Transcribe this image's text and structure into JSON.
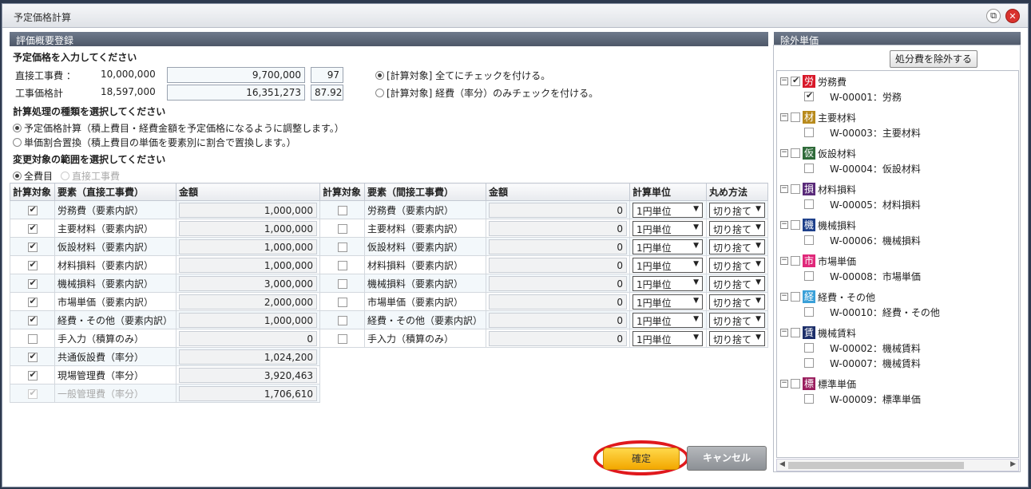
{
  "window": {
    "title": "予定価格計算"
  },
  "left": {
    "header": "評価概要登録",
    "price_section": {
      "label": "予定価格を入力してください",
      "direct": {
        "label": "直接工事費 ：",
        "base": "10,000,000",
        "value": "9,700,000",
        "ratio": "97"
      },
      "total": {
        "label": "工事価格計",
        "base": "18,597,000",
        "value": "16,351,273",
        "ratio": "87.92"
      },
      "check_opts": [
        "[計算対象] 全てにチェックを付ける。",
        "[計算対象] 経費（率分）のみチェックを付ける。"
      ]
    },
    "process_section": {
      "label": "計算処理の種類を選択してください",
      "options": [
        "予定価格計算（積上費目・経費金額を予定価格になるように調整します。）",
        "単価割合置換（積上費目の単価を要素別に割合で置換します。）"
      ]
    },
    "range_section": {
      "label": "変更対象の範囲を選択してください",
      "options": [
        "全費目",
        "直接工事費"
      ]
    },
    "table": {
      "headers": [
        "計算対象",
        "要素（直接工事費）",
        "金額",
        "計算対象",
        "要素（間接工事費）",
        "金額",
        "計算単位",
        "丸め方法"
      ],
      "rows": [
        {
          "name": "労務費（要素内訳）",
          "amount": "1,000,000",
          "name2": "労務費（要素内訳）",
          "amount2": "0",
          "unit": "1円単位",
          "round": "切り捨て"
        },
        {
          "name": "主要材料（要素内訳）",
          "amount": "1,000,000",
          "name2": "主要材料（要素内訳）",
          "amount2": "0",
          "unit": "1円単位",
          "round": "切り捨て"
        },
        {
          "name": "仮設材料（要素内訳）",
          "amount": "1,000,000",
          "name2": "仮設材料（要素内訳）",
          "amount2": "0",
          "unit": "1円単位",
          "round": "切り捨て"
        },
        {
          "name": "材料損料（要素内訳）",
          "amount": "1,000,000",
          "name2": "材料損料（要素内訳）",
          "amount2": "0",
          "unit": "1円単位",
          "round": "切り捨て"
        },
        {
          "name": "機械損料（要素内訳）",
          "amount": "3,000,000",
          "name2": "機械損料（要素内訳）",
          "amount2": "0",
          "unit": "1円単位",
          "round": "切り捨て"
        },
        {
          "name": "市場単価（要素内訳）",
          "amount": "2,000,000",
          "name2": "市場単価（要素内訳）",
          "amount2": "0",
          "unit": "1円単位",
          "round": "切り捨て"
        },
        {
          "name": "経費・その他（要素内訳）",
          "amount": "1,000,000",
          "name2": "経費・その他（要素内訳）",
          "amount2": "0",
          "unit": "1円単位",
          "round": "切り捨て"
        },
        {
          "name": "手入力（積算のみ）",
          "amount": "0",
          "name2": "手入力（積算のみ）",
          "amount2": "0",
          "unit": "1円単位",
          "round": "切り捨て"
        }
      ],
      "rate_rows": [
        {
          "name": "共通仮設費（率分）",
          "amount": "1,024,200"
        },
        {
          "name": "現場管理費（率分）",
          "amount": "3,920,463"
        },
        {
          "name": "一般管理費（率分）",
          "amount": "1,706,610"
        }
      ]
    },
    "buttons": {
      "ok": "確定",
      "cancel": "キャンセル"
    }
  },
  "right": {
    "header": "除外単価",
    "exclude_button": "処分費を除外する",
    "categories": [
      {
        "icon": "労",
        "color": "#d8192a",
        "label": "労務費",
        "items": [
          "W-00001：労務"
        ]
      },
      {
        "icon": "材",
        "color": "#b88a1c",
        "label": "主要材料",
        "items": [
          "W-00003：主要材料"
        ]
      },
      {
        "icon": "仮",
        "color": "#2f6b3a",
        "label": "仮設材料",
        "items": [
          "W-00004：仮設材料"
        ]
      },
      {
        "icon": "損",
        "color": "#5a2b7a",
        "label": "材料損料",
        "items": [
          "W-00005：材料損料"
        ]
      },
      {
        "icon": "機",
        "color": "#1d3f8a",
        "label": "機械損料",
        "items": [
          "W-00006：機械損料"
        ]
      },
      {
        "icon": "市",
        "color": "#e0287a",
        "label": "市場単価",
        "items": [
          "W-00008：市場単価"
        ]
      },
      {
        "icon": "経",
        "color": "#3aa0d8",
        "label": "経費・その他",
        "items": [
          "W-00010：経費・その他"
        ]
      },
      {
        "icon": "賃",
        "color": "#1d2f6a",
        "label": "機械賃料",
        "items": [
          "W-00002：機械賃料",
          "W-00007：機械賃料"
        ]
      },
      {
        "icon": "標",
        "color": "#9a1e5e",
        "label": "標準単価",
        "items": [
          "W-00009：標準単価"
        ]
      }
    ]
  }
}
